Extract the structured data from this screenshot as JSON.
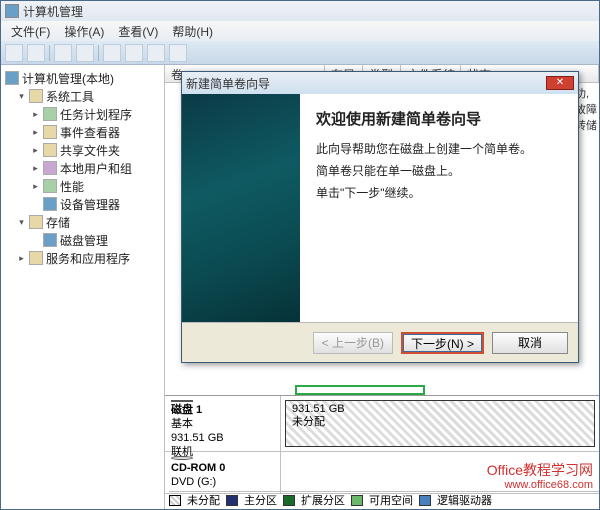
{
  "window": {
    "title": "计算机管理"
  },
  "menu": {
    "file": "文件(F)",
    "action": "操作(A)",
    "view": "查看(V)",
    "help": "帮助(H)"
  },
  "tree": {
    "root": "计算机管理(本地)",
    "system_tools": "系统工具",
    "task_scheduler": "任务计划程序",
    "event_viewer": "事件查看器",
    "shared_folders": "共享文件夹",
    "local_users": "本地用户和组",
    "performance": "性能",
    "device_manager": "设备管理器",
    "storage": "存储",
    "disk_management": "磁盘管理",
    "services_apps": "服务和应用程序"
  },
  "columns": {
    "volume": "卷",
    "layout": "布局",
    "type": "类型",
    "fs": "文件系统",
    "status": "状态"
  },
  "right_panel": {
    "actions_fault": "功, 故障转储"
  },
  "disk1": {
    "label": "磁盘 1",
    "kind": "基本",
    "size": "931.51 GB",
    "status": "联机",
    "part_size": "931.51 GB",
    "part_status": "未分配"
  },
  "cdrom": {
    "label": "CD-ROM 0",
    "drive": "DVD (G:)"
  },
  "legend": {
    "unalloc": "未分配",
    "primary": "主分区",
    "extended": "扩展分区",
    "free": "可用空间",
    "logical": "逻辑驱动器"
  },
  "wizard": {
    "title": "新建简单卷向导",
    "heading": "欢迎使用新建简单卷向导",
    "line1": "此向导帮助您在磁盘上创建一个简单卷。",
    "line2": "简单卷只能在单一磁盘上。",
    "line3": "单击\"下一步\"继续。",
    "back": "< 上一步(B)",
    "next": "下一步(N) >",
    "cancel": "取消"
  },
  "watermark": {
    "line1": "Office教程学习网",
    "line2": "www.office68.com"
  }
}
